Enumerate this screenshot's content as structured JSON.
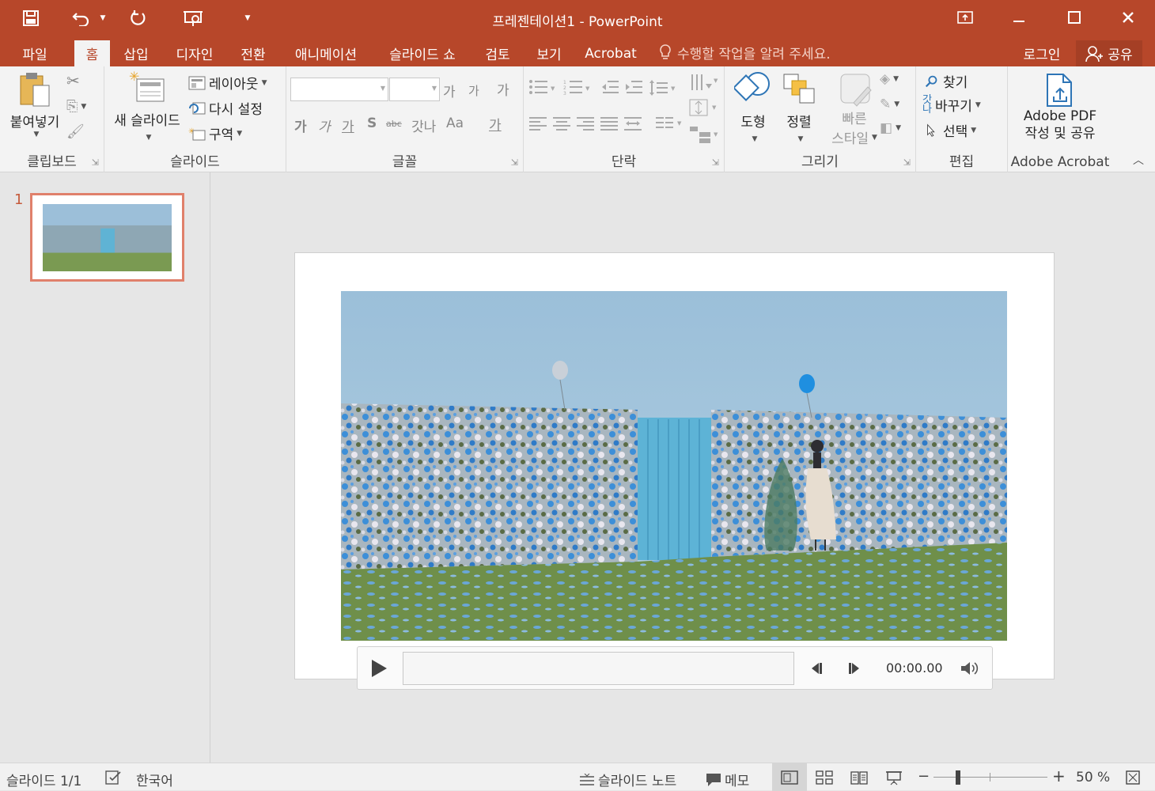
{
  "app": {
    "title": "프레젠테이션1 - PowerPoint"
  },
  "tabs": [
    {
      "label": "파일"
    },
    {
      "label": "홈"
    },
    {
      "label": "삽입"
    },
    {
      "label": "디자인"
    },
    {
      "label": "전환"
    },
    {
      "label": "애니메이션"
    },
    {
      "label": "슬라이드 쇼"
    },
    {
      "label": "검토"
    },
    {
      "label": "보기"
    },
    {
      "label": "Acrobat"
    }
  ],
  "tell_me": "수행할 작업을 알려 주세요.",
  "account": {
    "login": "로그인",
    "share": "공유"
  },
  "ribbon": {
    "clipboard": {
      "label": "클립보드",
      "paste": "붙여넣기"
    },
    "slides": {
      "label": "슬라이드",
      "new_slide": "새 슬라이드",
      "layout": "레이아웃",
      "reset": "다시 설정",
      "section": "구역"
    },
    "font": {
      "label": "글꼴",
      "grow": "가",
      "shrink": "가",
      "clear": "가",
      "bold": "가",
      "italic": "가",
      "underline": "가",
      "shadow": "S",
      "strike": "abc",
      "spacing": "갓나",
      "case": "Aa",
      "color": "가"
    },
    "paragraph": {
      "label": "단락"
    },
    "drawing": {
      "label": "그리기",
      "shapes": "도형",
      "arrange": "정렬",
      "quick_styles_1": "빠른",
      "quick_styles_2": "스타일"
    },
    "editing": {
      "label": "편집",
      "find": "찾기",
      "replace": "바꾸기",
      "select": "선택"
    },
    "acrobat": {
      "label": "Adobe Acrobat",
      "create_1": "Adobe PDF",
      "create_2": "작성 및 공유"
    }
  },
  "thumbnails": [
    {
      "number": "1"
    }
  ],
  "media": {
    "time": "00:00.00"
  },
  "status": {
    "slide_info": "슬라이드 1/1",
    "language": "한국어",
    "notes": "슬라이드 노트",
    "comments": "메모",
    "zoom_level": "50 %"
  },
  "colors": {
    "accent": "#b7472a",
    "thumb_border": "#e0806b"
  }
}
